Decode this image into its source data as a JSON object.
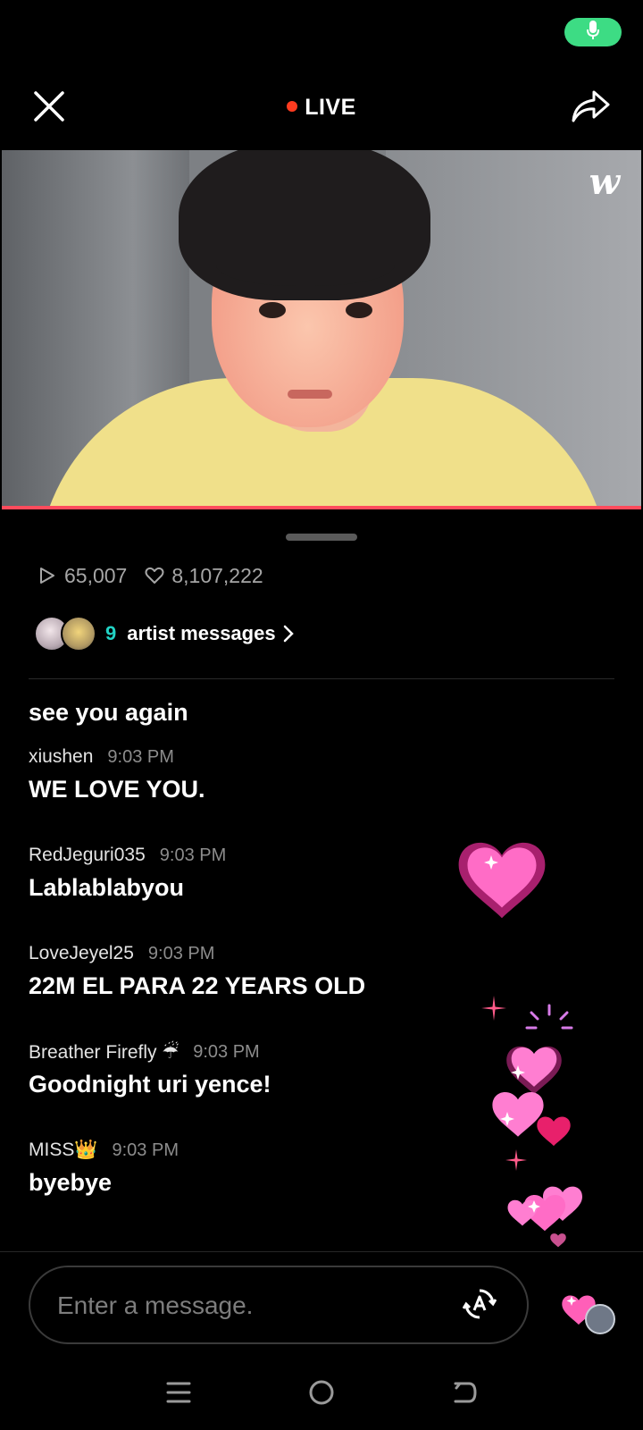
{
  "status_bar": {
    "mic_icon": "mic-icon",
    "mic_color": "#3ddc84"
  },
  "header": {
    "live_label": "LIVE",
    "live_dot_color": "#ff3b1f",
    "close_icon": "close-icon",
    "share_icon": "share-icon"
  },
  "video": {
    "brand_logo": "w",
    "progress_color": "#ff4b5c"
  },
  "stats": {
    "plays": "65,007",
    "likes": "8,107,222"
  },
  "artist_messages": {
    "count": "9",
    "label": "artist messages"
  },
  "chat": {
    "partial_message": "see you again",
    "messages": [
      {
        "user": "xiushen",
        "time": "9:03 PM",
        "text": "WE LOVE YOU."
      },
      {
        "user": "RedJeguri035",
        "time": "9:03 PM",
        "text": "Lablablabyou"
      },
      {
        "user": "LoveJeyel25",
        "time": "9:03 PM",
        "text": "22M EL PARA 22 YEARS OLD"
      },
      {
        "user": "Breather Firefly ☔",
        "time": "9:03 PM",
        "text": "Goodnight uri yence!"
      },
      {
        "user": "MISS👑",
        "time": "9:03 PM",
        "text": "byebye"
      }
    ]
  },
  "input": {
    "placeholder": "Enter a message."
  },
  "colors": {
    "accent_teal": "#22d3c5",
    "heart_pink": "#ff5fb8"
  },
  "nav": {
    "icons": [
      "menu-icon",
      "home-icon",
      "back-icon"
    ]
  }
}
